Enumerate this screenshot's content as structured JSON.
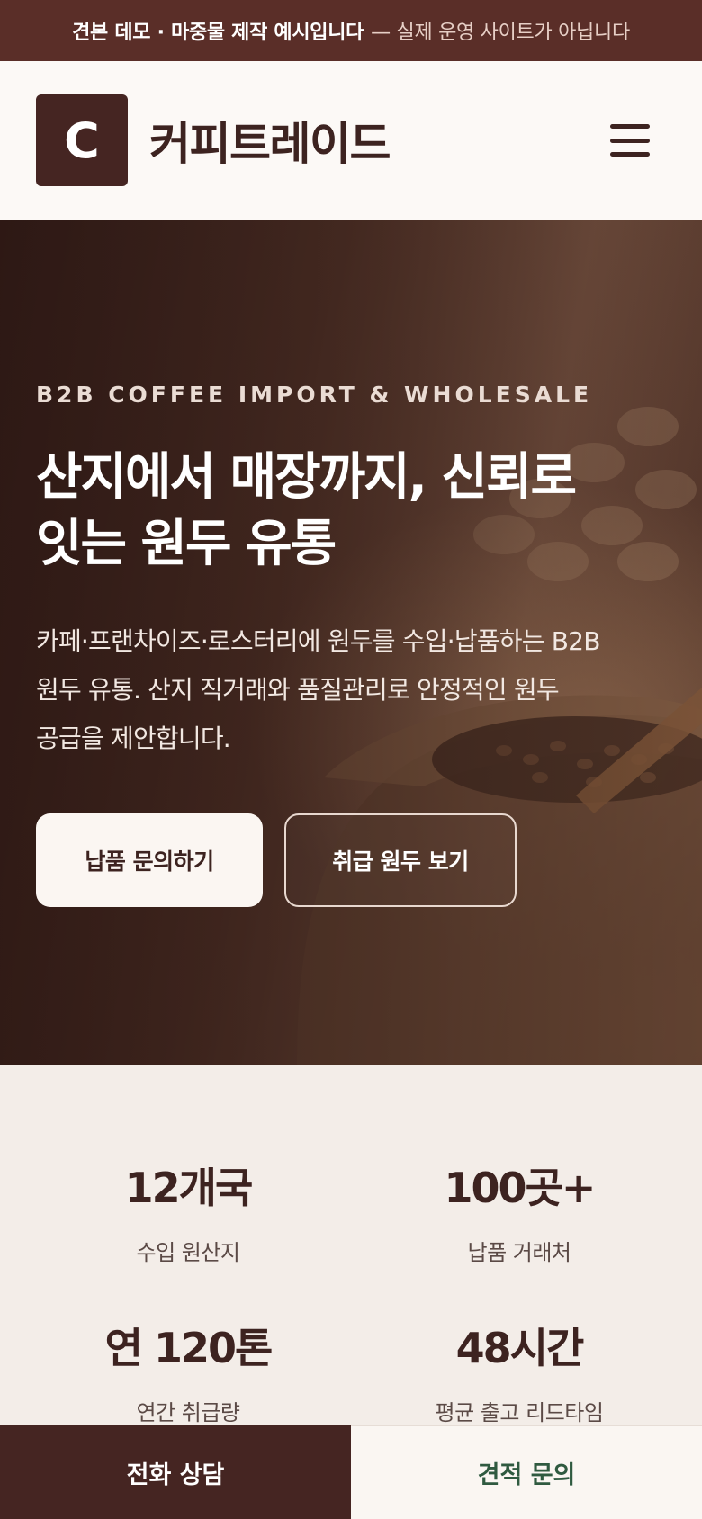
{
  "notice": {
    "strong": "견본 데모 · 마중물 제작 예시입니다",
    "light": "— 실제 운영 사이트가 아닙니다"
  },
  "header": {
    "logo_letter": "C",
    "brand": "커피트레이드",
    "menu_icon": "hamburger-menu-icon"
  },
  "hero": {
    "eyebrow": "B2B COFFEE IMPORT & WHOLESALE",
    "title_line1": "산지에서 매장까지, 신뢰로",
    "title_line2": "잇는 원두 유통",
    "desc_line1": "카페·프랜차이즈·로스터리에 원두를 수입·납품하는 B2B",
    "desc_line2": "원두 유통. 산지 직거래와 품질관리로 안정적인 원두",
    "desc_line3": "공급을 제안합니다.",
    "primary_button": "납품 문의하기",
    "secondary_button": "취급 원두 보기"
  },
  "stats": [
    {
      "value": "12개국",
      "label": "수입 원산지"
    },
    {
      "value": "100곳+",
      "label": "납품 거래처"
    },
    {
      "value": "연 120톤",
      "label": "연간 취급량"
    },
    {
      "value": "48시간",
      "label": "평균 출고 리드타임"
    }
  ],
  "bottom_bar": {
    "call": "전화 상담",
    "quote": "견적 문의"
  },
  "colors": {
    "brand_dark": "#452522",
    "notice_bg": "#5a2e28",
    "quote_text": "#2f5a40"
  }
}
